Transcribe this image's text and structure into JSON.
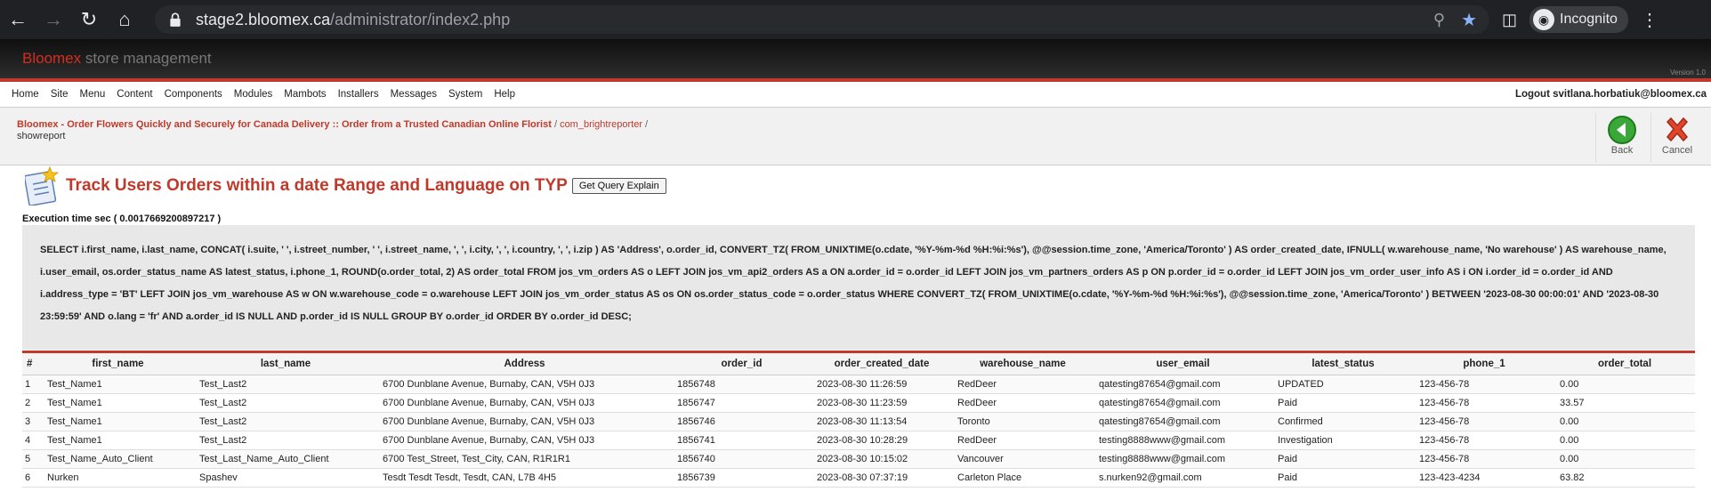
{
  "browser": {
    "url_host": "stage2.bloomex.ca",
    "url_path": "/administrator/index2.php",
    "incognito_label": "Incognito"
  },
  "brand": {
    "name_red": "Bloomex",
    "name_grey": "store management",
    "version": "Version 1.0"
  },
  "menu": {
    "items": [
      "Home",
      "Site",
      "Menu",
      "Content",
      "Components",
      "Modules",
      "Mambots",
      "Installers",
      "Messages",
      "System",
      "Help"
    ],
    "logout": "Logout svitlana.horbatiuk@bloomex.ca"
  },
  "path": {
    "site_link": "Bloomex - Order Flowers Quickly and Securely for Canada Delivery :: Order from a Trusted Canadian Online Florist",
    "sep1": " / ",
    "component": "com_brightreporter",
    "sep2": " /",
    "task": "showreport"
  },
  "toolbar": {
    "back_label": "Back",
    "cancel_label": "Cancel"
  },
  "report": {
    "title": "Track Users Orders within a date Range and Language on TYP",
    "explain_button": "Get Query Explain",
    "execution_time": "Execution time sec ( 0.0017669200897217 )",
    "sql": "SELECT i.first_name, i.last_name, CONCAT( i.suite, ' ', i.street_number, ' ', i.street_name, ', ', i.city, ', ', i.country, ', ', i.zip ) AS 'Address', o.order_id, CONVERT_TZ( FROM_UNIXTIME(o.cdate, '%Y-%m-%d %H:%i:%s'), @@session.time_zone, 'America/Toronto' ) AS order_created_date, IFNULL( w.warehouse_name, 'No warehouse' ) AS warehouse_name, i.user_email, os.order_status_name AS latest_status, i.phone_1, ROUND(o.order_total, 2) AS order_total FROM jos_vm_orders AS o LEFT JOIN jos_vm_api2_orders AS a ON a.order_id = o.order_id LEFT JOIN jos_vm_partners_orders AS p ON p.order_id = o.order_id LEFT JOIN jos_vm_order_user_info AS i ON i.order_id = o.order_id AND i.address_type = 'BT' LEFT JOIN jos_vm_warehouse AS w ON w.warehouse_code = o.warehouse LEFT JOIN jos_vm_order_status AS os ON os.order_status_code = o.order_status WHERE CONVERT_TZ( FROM_UNIXTIME(o.cdate, '%Y-%m-%d %H:%i:%s'), @@session.time_zone, 'America/Toronto' ) BETWEEN '2023-08-30 00:00:01' AND '2023-08-30 23:59:59' AND o.lang = 'fr' AND a.order_id IS NULL AND p.order_id IS NULL GROUP BY o.order_id ORDER BY o.order_id DESC;"
  },
  "table": {
    "columns": [
      "#",
      "first_name",
      "last_name",
      "Address",
      "order_id",
      "order_created_date",
      "warehouse_name",
      "user_email",
      "latest_status",
      "phone_1",
      "order_total"
    ],
    "rows": [
      [
        "1",
        "Test_Name1",
        "Test_Last2",
        "6700 Dunblane Avenue, Burnaby, CAN, V5H 0J3",
        "1856748",
        "2023-08-30 11:26:59",
        "RedDeer",
        "qatesting87654@gmail.com",
        "UPDATED",
        "123-456-78",
        "0.00"
      ],
      [
        "2",
        "Test_Name1",
        "Test_Last2",
        "6700 Dunblane Avenue, Burnaby, CAN, V5H 0J3",
        "1856747",
        "2023-08-30 11:23:59",
        "RedDeer",
        "qatesting87654@gmail.com",
        "Paid",
        "123-456-78",
        "33.57"
      ],
      [
        "3",
        "Test_Name1",
        "Test_Last2",
        "6700 Dunblane Avenue, Burnaby, CAN, V5H 0J3",
        "1856746",
        "2023-08-30 11:13:54",
        "Toronto",
        "qatesting87654@gmail.com",
        "Confirmed",
        "123-456-78",
        "0.00"
      ],
      [
        "4",
        "Test_Name1",
        "Test_Last2",
        "6700 Dunblane Avenue, Burnaby, CAN, V5H 0J3",
        "1856741",
        "2023-08-30 10:28:29",
        "RedDeer",
        "testing8888www@gmail.com",
        "Investigation",
        "123-456-78",
        "0.00"
      ],
      [
        "5",
        "Test_Name_Auto_Client",
        "Test_Last_Name_Auto_Client",
        "6700 Test_Street, Test_City, CAN, R1R1R1",
        "1856740",
        "2023-08-30 10:15:02",
        "Vancouver",
        "testing8888www@gmail.com",
        "Paid",
        "123-456-78",
        "0.00"
      ],
      [
        "6",
        "Nurken",
        "Spashev",
        "Tesdt Tesdt Tesdt, Tesdt, CAN, L7B 4H5",
        "1856739",
        "2023-08-30 07:37:19",
        "Carleton Place",
        "s.nurken92@gmail.com",
        "Paid",
        "123-423-4234",
        "63.82"
      ]
    ]
  }
}
